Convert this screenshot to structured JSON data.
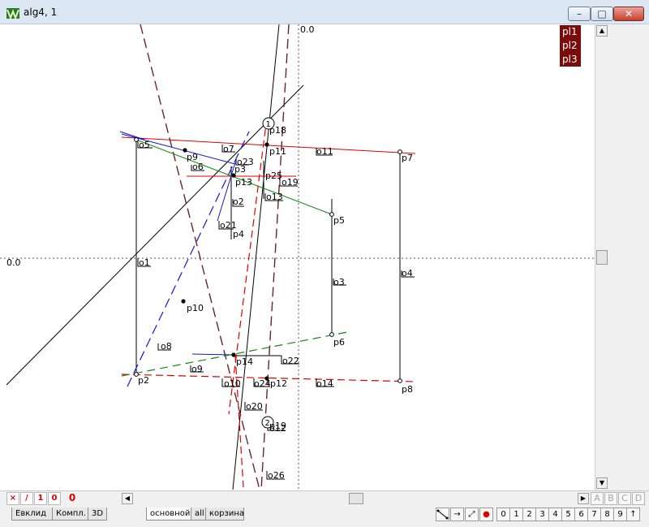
{
  "window": {
    "title": "alg4, 1",
    "minimize_glyph": "–",
    "maximize_glyph": "□",
    "close_glyph": "✕",
    "app_icon": "geometry-app-icon"
  },
  "canvas": {
    "axis_labels": {
      "vertical_origin": "0.0",
      "horizontal_origin": "0.0"
    },
    "points": [
      {
        "id": "1",
        "circled": true
      },
      {
        "id": "2",
        "circled": true
      }
    ],
    "labels": [
      "p18",
      "p11",
      "o11",
      "p7",
      "o5",
      "p9",
      "o7",
      "o6",
      "p3",
      "o23",
      "p13",
      "p25",
      "o19",
      "o2",
      "o13",
      "p5",
      "o21",
      "p4",
      "o1",
      "o3",
      "o4",
      "p10",
      "o8",
      "p6",
      "o22",
      "p14",
      "p2",
      "o9",
      "o10",
      "o24",
      "p12",
      "o14",
      "p8",
      "o20",
      "p19",
      "o12",
      "o26"
    ],
    "colors": {
      "red": "#e00000",
      "blue": "#1515d8",
      "green": "#128a12",
      "brown": "#6b2424",
      "black": "#000000"
    }
  },
  "planes": [
    "pl1",
    "pl2",
    "pl3"
  ],
  "statusbar": {
    "mode_icons": [
      "×",
      "∕",
      "1",
      "0"
    ],
    "mode_value": "0",
    "letter_buttons": [
      "A",
      "B",
      "C",
      "D"
    ],
    "scroll_left_glyph": "◀",
    "scroll_right_glyph": "▶"
  },
  "tabs": {
    "left": [
      "Евклид",
      "Компл.",
      "3D"
    ],
    "right": [
      "основной",
      "all",
      "корзина"
    ],
    "active": "основной"
  },
  "toolbar": {
    "tools": [
      "segment-tool-icon",
      "arrow-right-icon",
      "diagonal-arrow-icon",
      "record-dot-icon"
    ],
    "digits": [
      "0",
      "1",
      "2",
      "3",
      "4",
      "5",
      "6",
      "7",
      "8",
      "9",
      "↑"
    ]
  }
}
